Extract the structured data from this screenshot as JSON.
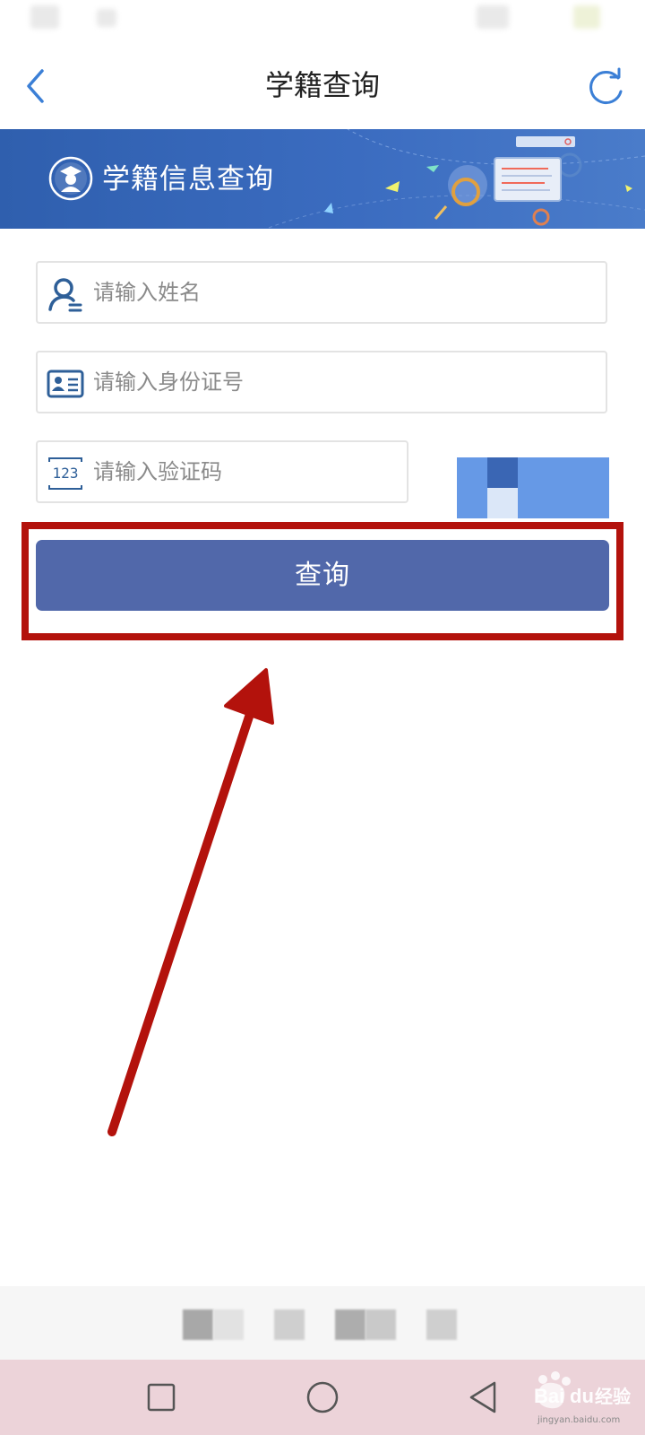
{
  "header": {
    "title": "学籍查询"
  },
  "banner": {
    "title": "学籍信息查询"
  },
  "form": {
    "name_placeholder": "请输入姓名",
    "id_placeholder": "请输入身份证号",
    "captcha_placeholder": "请输入验证码",
    "captcha_icon_text": "123",
    "query_label": "查询"
  },
  "watermark": {
    "text": "jingyan.baidu.com"
  },
  "colors": {
    "accent_blue": "#3b7fd6",
    "banner_blue": "#3b6cc0",
    "button": "#5168aa",
    "highlight_red": "#b3120c",
    "navbar_pink": "#ecd3d9"
  },
  "icons": {
    "back": "chevron-left-icon",
    "refresh": "refresh-icon",
    "name": "user-icon",
    "id": "id-card-icon",
    "captcha": "number-icon",
    "nav_recent": "square-icon",
    "nav_home": "circle-icon",
    "nav_back": "triangle-back-icon"
  }
}
